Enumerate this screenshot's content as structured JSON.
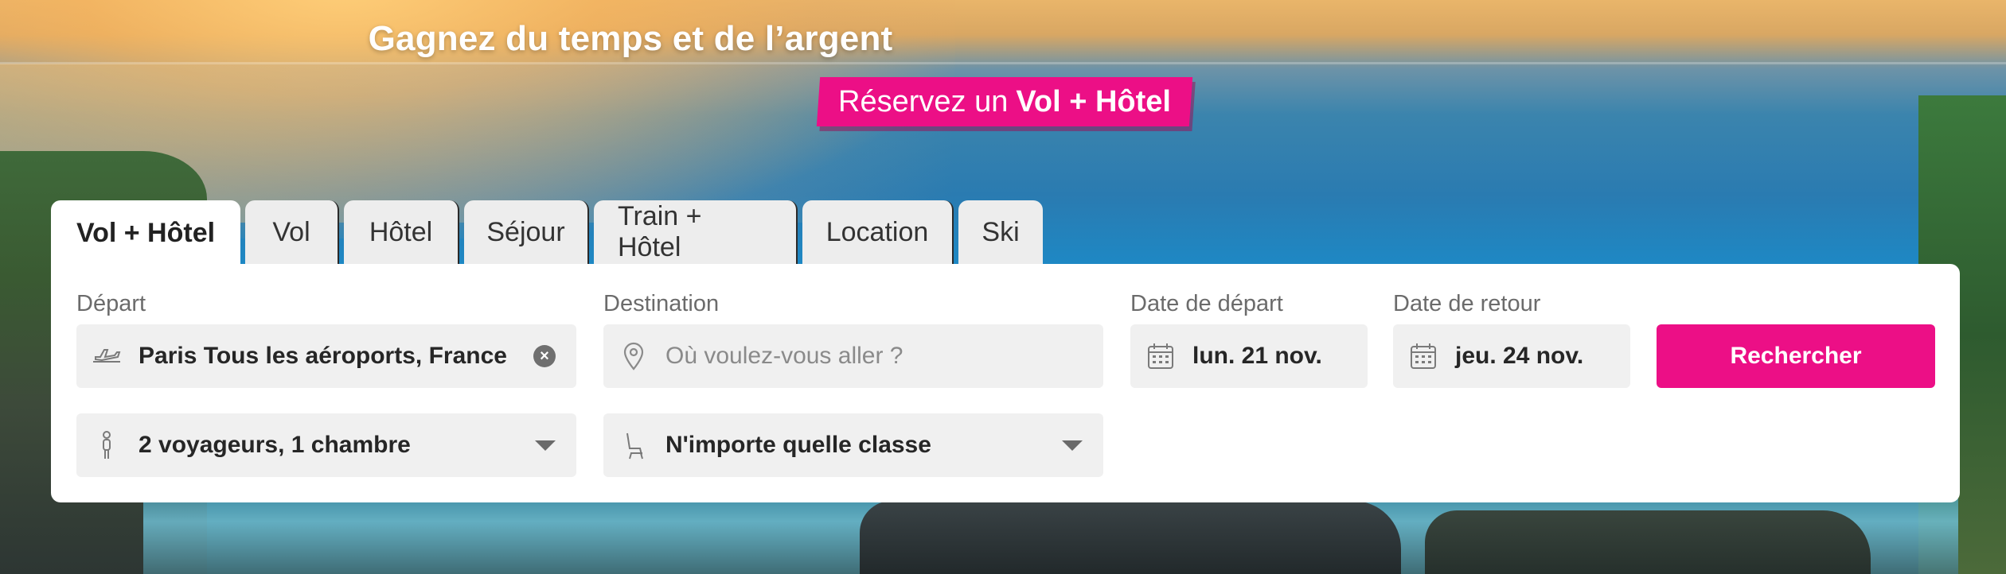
{
  "hero": {
    "headline": "Gagnez du temps et de l’argent",
    "promo_prefix": "Réservez un",
    "promo_bold": "Vol + Hôtel"
  },
  "tabs": [
    {
      "label": "Vol + Hôtel",
      "active": true
    },
    {
      "label": "Vol",
      "active": false
    },
    {
      "label": "Hôtel",
      "active": false
    },
    {
      "label": "Séjour",
      "active": false
    },
    {
      "label": "Train + Hôtel",
      "active": false
    },
    {
      "label": "Location",
      "active": false
    },
    {
      "label": "Ski",
      "active": false
    }
  ],
  "form": {
    "departure": {
      "label": "Départ",
      "value": "Paris Tous les aéroports, France",
      "icon": "plane-takeoff-icon"
    },
    "destination": {
      "label": "Destination",
      "placeholder": "Où voulez-vous aller ?",
      "value": "",
      "icon": "location-pin-icon"
    },
    "date_depart": {
      "label": "Date de départ",
      "value": "lun. 21 nov.",
      "icon": "calendar-icon"
    },
    "date_return": {
      "label": "Date de retour",
      "value": "jeu. 24 nov.",
      "icon": "calendar-icon"
    },
    "travellers": {
      "value": "2 voyageurs, 1 chambre",
      "icon": "person-icon"
    },
    "cabin_class": {
      "value": "N'importe quelle classe",
      "icon": "seat-icon"
    },
    "search_label": "Rechercher"
  },
  "colors": {
    "accent": "#ec0f86",
    "field_bg": "#f0f0f0",
    "panel_bg": "#ffffff"
  }
}
